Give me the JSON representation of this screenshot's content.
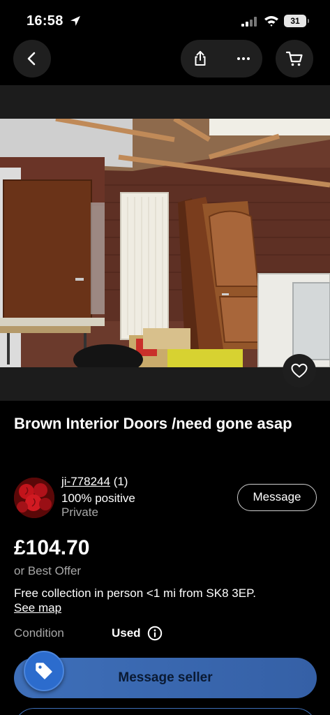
{
  "status_bar": {
    "time": "16:58",
    "battery": "31"
  },
  "listing": {
    "title": "Brown Interior Doors /need gone asap",
    "price": "£104.70",
    "offer": "or Best Offer",
    "collection": "Free collection in person <1 mi from SK8 3EP.",
    "see_map": "See map",
    "condition_label": "Condition",
    "condition_value": "Used"
  },
  "seller": {
    "username": "ji-778244",
    "feedback": "(1)",
    "positive": "100% positive",
    "type": "Private",
    "message_label": "Message"
  },
  "actions": {
    "message_seller": "Message seller"
  },
  "icons": [
    "location-arrow-icon",
    "signal-icon",
    "wifi-icon",
    "back-icon",
    "share-icon",
    "more-icon",
    "cart-icon",
    "heart-icon",
    "info-icon",
    "tag-icon"
  ],
  "colors": {
    "accent": "#3e6fb9",
    "tag_badge": "#2c6ccd",
    "background": "#000000"
  }
}
